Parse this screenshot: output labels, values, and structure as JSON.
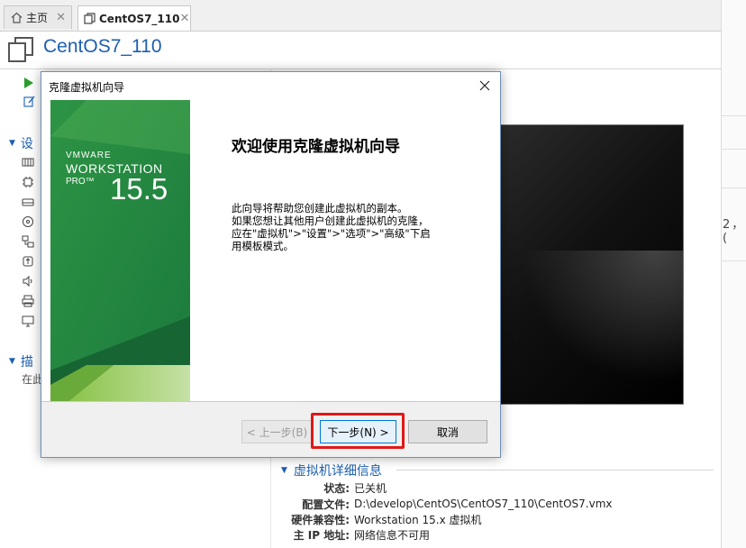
{
  "tabs": [
    {
      "label": "主页",
      "icon": "home-icon"
    },
    {
      "label": "CentOS7_110",
      "icon": "vm-icon"
    }
  ],
  "vm_title": "CentOS7_110",
  "left_panel": {
    "section_devices": "设",
    "section_description": "描",
    "description_placeholder": "在此"
  },
  "right_fragment": "2，(",
  "details": {
    "heading": "虚拟机详细信息",
    "rows": [
      {
        "key": "状态:",
        "value": "已关机"
      },
      {
        "key": "配置文件:",
        "value": "D:\\develop\\CentOS\\CentOS7_110\\CentOS7.vmx"
      },
      {
        "key": "硬件兼容性:",
        "value": "Workstation 15.x 虚拟机"
      },
      {
        "key": "主 IP 地址:",
        "value": "网络信息不可用"
      }
    ]
  },
  "dialog": {
    "title": "克隆虚拟机向导",
    "brand": {
      "vmware": "VMWARE",
      "product": "WORKSTATION",
      "edition": "PRO™",
      "version": "15.5"
    },
    "heading": "欢迎使用克隆虚拟机向导",
    "body_lines": [
      "此向导将帮助您创建此虚拟机的副本。",
      "如果您想让其他用户创建此虚拟机的克隆，",
      "应在\"虚拟机\">\"设置\">\"选项\">\"高级\"下启",
      "用模板模式。"
    ],
    "buttons": {
      "back": "< 上一步(B)",
      "next": "下一步(N) >",
      "cancel": "取消"
    }
  },
  "colors": {
    "accent": "#1c5fb0",
    "highlight": "#e01818",
    "banner_green": "#1e7a3c"
  }
}
